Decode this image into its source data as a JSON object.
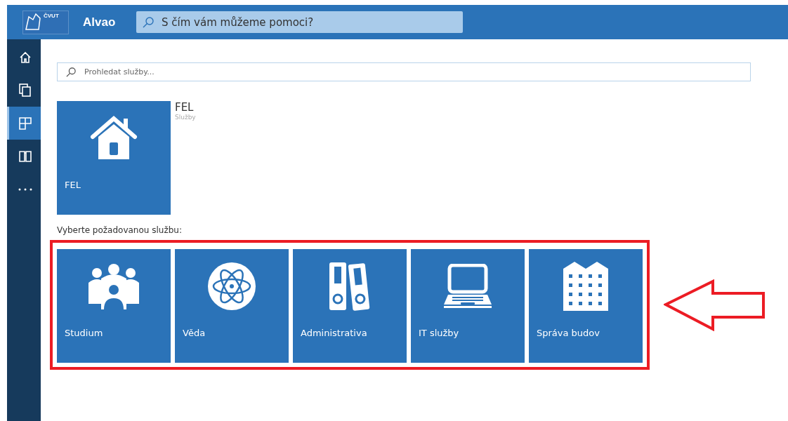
{
  "header": {
    "logo_text": "ČVUT",
    "app_name": "Alvao",
    "search": {
      "placeholder": "S čím vám můžeme pomoci?"
    }
  },
  "sidebar": {
    "items": [
      {
        "kind": "home",
        "selected": false
      },
      {
        "kind": "copies",
        "selected": false
      },
      {
        "kind": "tiles",
        "selected": true
      },
      {
        "kind": "book",
        "selected": false
      },
      {
        "kind": "more",
        "selected": false
      }
    ]
  },
  "search": {
    "placeholder": "Prohledat služby..."
  },
  "category": {
    "tile_label": "FEL",
    "title": "FEL",
    "subtitle": "Služby",
    "kind": "house"
  },
  "prompt": "Vyberte požadovanou službu:",
  "services": [
    {
      "label": "Studium",
      "kind": "people"
    },
    {
      "label": "Věda",
      "kind": "atom"
    },
    {
      "label": "Administrativa",
      "kind": "binders"
    },
    {
      "label": "IT služby",
      "kind": "laptop"
    },
    {
      "label": "Správa budov",
      "kind": "building"
    }
  ],
  "annotation": {
    "highlight": true
  }
}
